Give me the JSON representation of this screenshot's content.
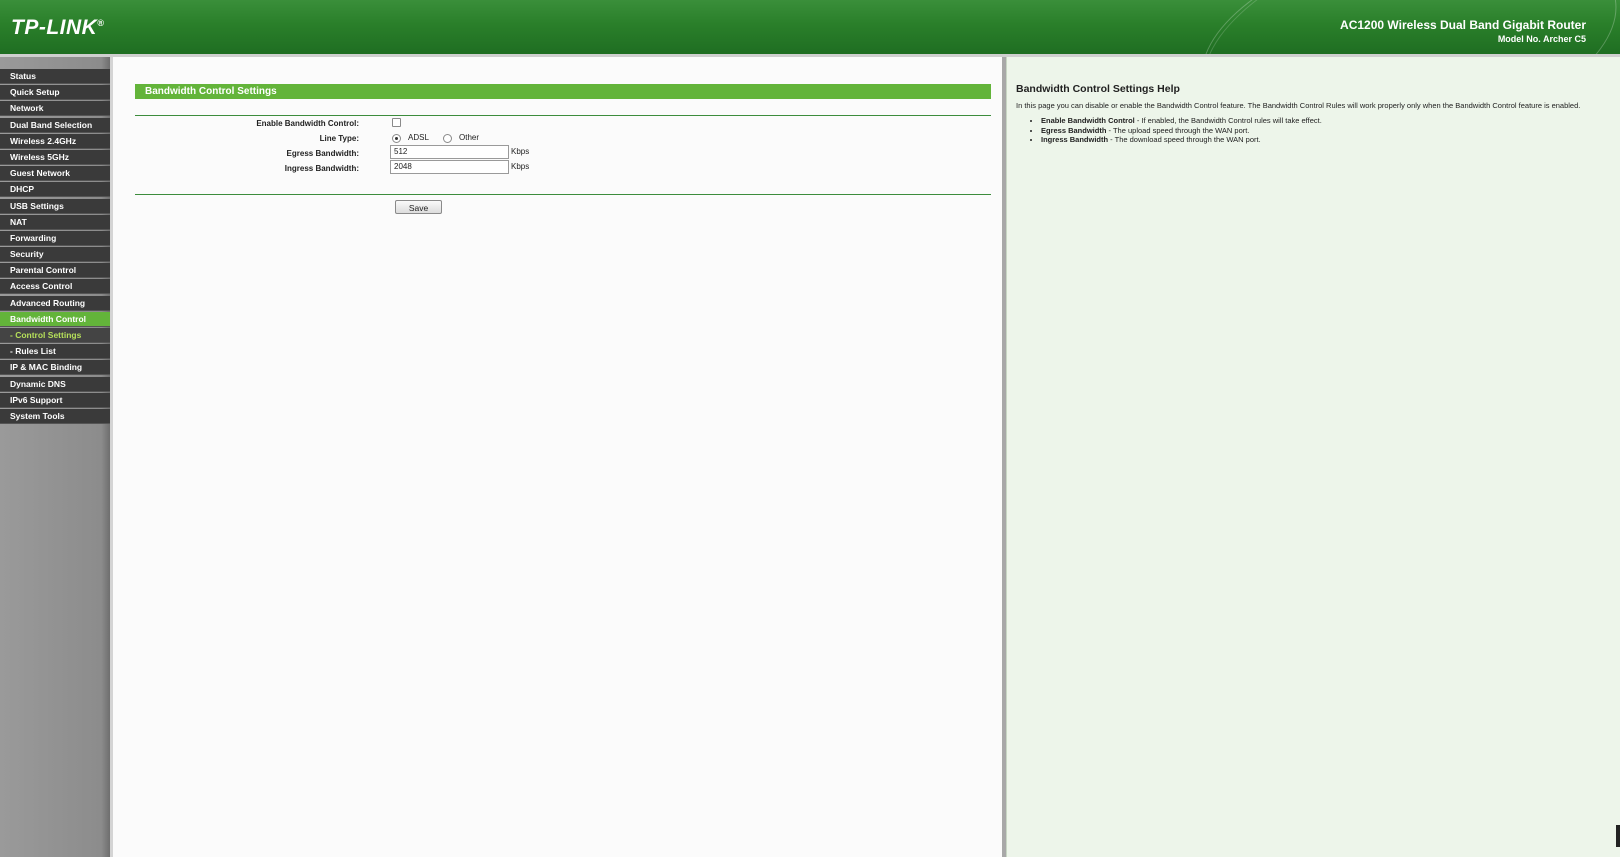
{
  "header": {
    "logo": "TP-LINK",
    "logo_mark": "®",
    "product": "AC1200 Wireless Dual Band Gigabit Router",
    "model": "Model No. Archer C5"
  },
  "sidebar": {
    "items": [
      {
        "label": "Status"
      },
      {
        "label": "Quick Setup"
      },
      {
        "label": "Network"
      },
      {
        "label": "Dual Band Selection"
      },
      {
        "label": "Wireless 2.4GHz"
      },
      {
        "label": "Wireless 5GHz"
      },
      {
        "label": "Guest Network"
      },
      {
        "label": "DHCP"
      },
      {
        "label": "USB Settings"
      },
      {
        "label": "NAT"
      },
      {
        "label": "Forwarding"
      },
      {
        "label": "Security"
      },
      {
        "label": "Parental Control"
      },
      {
        "label": "Access Control"
      },
      {
        "label": "Advanced Routing"
      },
      {
        "label": "Bandwidth Control"
      },
      {
        "label": "- Control Settings"
      },
      {
        "label": "- Rules List"
      },
      {
        "label": "IP & MAC Binding"
      },
      {
        "label": "Dynamic DNS"
      },
      {
        "label": "IPv6 Support"
      },
      {
        "label": "System Tools"
      }
    ]
  },
  "main": {
    "title": "Bandwidth Control Settings",
    "enable_label": "Enable Bandwidth Control:",
    "enable_checked": false,
    "line_type_label": "Line Type:",
    "line_type_options": [
      "ADSL",
      "Other"
    ],
    "line_type_selected": "ADSL",
    "egress_label": "Egress Bandwidth:",
    "egress_value": "512",
    "egress_unit": "Kbps",
    "ingress_label": "Ingress Bandwidth:",
    "ingress_value": "2048",
    "ingress_unit": "Kbps",
    "save_label": "Save"
  },
  "help": {
    "title": "Bandwidth Control Settings Help",
    "intro": "In this page you can disable or enable the Bandwidth Control feature. The Bandwidth Control Rules will work properly only when the Bandwidth Control feature is enabled.",
    "items": [
      {
        "term": "Enable Bandwidth Control",
        "desc": " - If enabled, the Bandwidth Control rules will take effect."
      },
      {
        "term": "Egress Bandwidth",
        "desc": " - The upload speed through the WAN port."
      },
      {
        "term": "Ingress Bandwidth",
        "desc": " - The download speed through the WAN port."
      }
    ]
  },
  "colors": {
    "brand_green": "#2a7f2a",
    "accent_green": "#63b43a",
    "menu_dark": "#3a3a3a",
    "help_bg": "#edf5ea"
  }
}
